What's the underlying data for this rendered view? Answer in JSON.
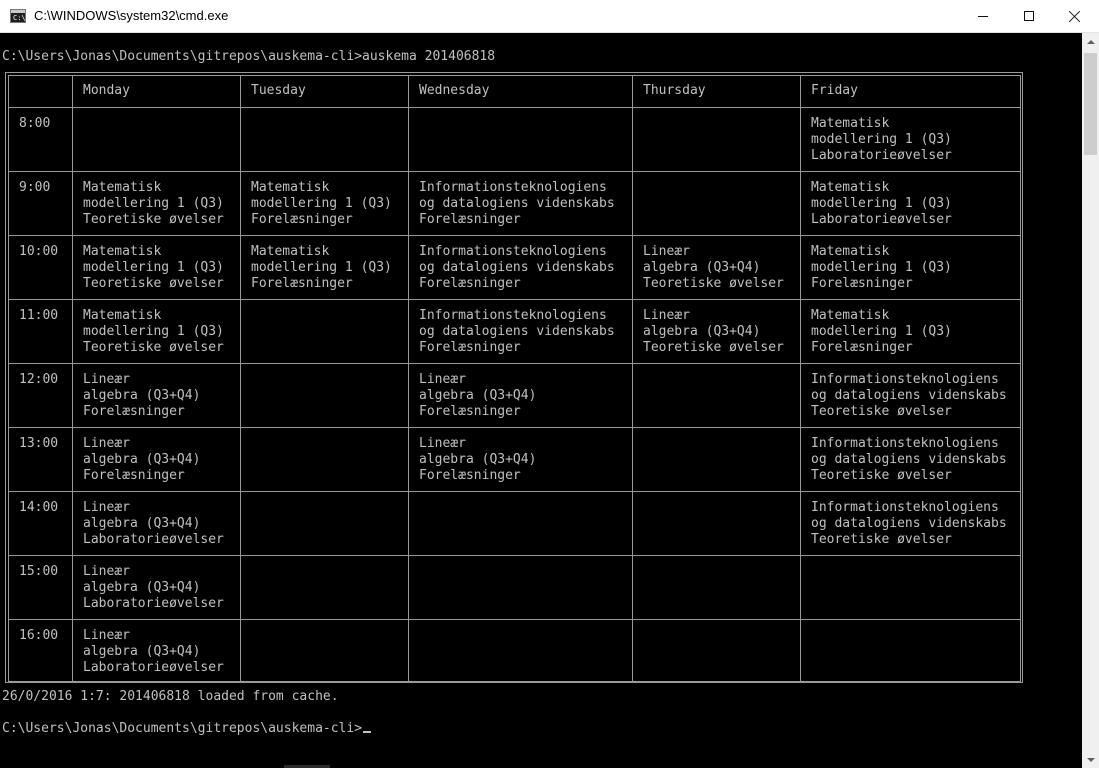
{
  "window": {
    "title": "C:\\WINDOWS\\system32\\cmd.exe",
    "icon": "cmd-icon",
    "icon_text": "C:\\"
  },
  "console": {
    "command_line": "C:\\Users\\Jonas\\Documents\\gitrepos\\auskema-cli>auskema 201406818",
    "status_line": "26/0/2016 1:7: 201406818 loaded from cache.",
    "prompt_line": "C:\\Users\\Jonas\\Documents\\gitrepos\\auskema-cli>"
  },
  "timetable": {
    "headers": [
      "",
      "Monday",
      "Tuesday",
      "Wednesday",
      "Thursday",
      "Friday"
    ],
    "rows": [
      {
        "time": "8:00",
        "cells": [
          [],
          [],
          [],
          [],
          [
            "Matematisk",
            "modellering 1 (Q3)",
            "Laboratorieøvelser"
          ]
        ]
      },
      {
        "time": "9:00",
        "cells": [
          [
            "Matematisk",
            "modellering 1 (Q3)",
            "Teoretiske øvelser"
          ],
          [
            "Matematisk",
            "modellering 1 (Q3)",
            "Forelæsninger"
          ],
          [
            "Informationsteknologiens",
            "og datalogiens videnskabs",
            "Forelæsninger"
          ],
          [],
          [
            "Matematisk",
            "modellering 1 (Q3)",
            "Laboratorieøvelser"
          ]
        ]
      },
      {
        "time": "10:00",
        "cells": [
          [
            "Matematisk",
            "modellering 1 (Q3)",
            "Teoretiske øvelser"
          ],
          [
            "Matematisk",
            "modellering 1 (Q3)",
            "Forelæsninger"
          ],
          [
            "Informationsteknologiens",
            "og datalogiens videnskabs",
            "Forelæsninger"
          ],
          [
            "Lineær",
            "algebra (Q3+Q4)",
            "Teoretiske øvelser"
          ],
          [
            "Matematisk",
            "modellering 1 (Q3)",
            "Forelæsninger"
          ]
        ]
      },
      {
        "time": "11:00",
        "cells": [
          [
            "Matematisk",
            "modellering 1 (Q3)",
            "Teoretiske øvelser"
          ],
          [],
          [
            "Informationsteknologiens",
            "og datalogiens videnskabs",
            "Forelæsninger"
          ],
          [
            "Lineær",
            "algebra (Q3+Q4)",
            "Teoretiske øvelser"
          ],
          [
            "Matematisk",
            "modellering 1 (Q3)",
            "Forelæsninger"
          ]
        ]
      },
      {
        "time": "12:00",
        "cells": [
          [
            "Lineær",
            "algebra (Q3+Q4)",
            "Forelæsninger"
          ],
          [],
          [
            "Lineær",
            "algebra (Q3+Q4)",
            "Forelæsninger"
          ],
          [],
          [
            "Informationsteknologiens",
            "og datalogiens videnskabs",
            "Teoretiske øvelser"
          ]
        ]
      },
      {
        "time": "13:00",
        "cells": [
          [
            "Lineær",
            "algebra (Q3+Q4)",
            "Forelæsninger"
          ],
          [],
          [
            "Lineær",
            "algebra (Q3+Q4)",
            "Forelæsninger"
          ],
          [],
          [
            "Informationsteknologiens",
            "og datalogiens videnskabs",
            "Teoretiske øvelser"
          ]
        ]
      },
      {
        "time": "14:00",
        "cells": [
          [
            "Lineær",
            "algebra (Q3+Q4)",
            "Laboratorieøvelser"
          ],
          [],
          [],
          [],
          [
            "Informationsteknologiens",
            "og datalogiens videnskabs",
            "Teoretiske øvelser"
          ]
        ]
      },
      {
        "time": "15:00",
        "cells": [
          [
            "Lineær",
            "algebra (Q3+Q4)",
            "Laboratorieøvelser"
          ],
          [],
          [],
          [],
          []
        ]
      },
      {
        "time": "16:00",
        "cells": [
          [
            "Lineær",
            "algebra (Q3+Q4)",
            "Laboratorieøvelser"
          ],
          [],
          [],
          [],
          []
        ]
      }
    ]
  },
  "colors": {
    "console_background": "#000000",
    "console_text": "#c0c0c0",
    "grid_lines": "#9a9a9a",
    "titlebar": "#ffffff"
  }
}
